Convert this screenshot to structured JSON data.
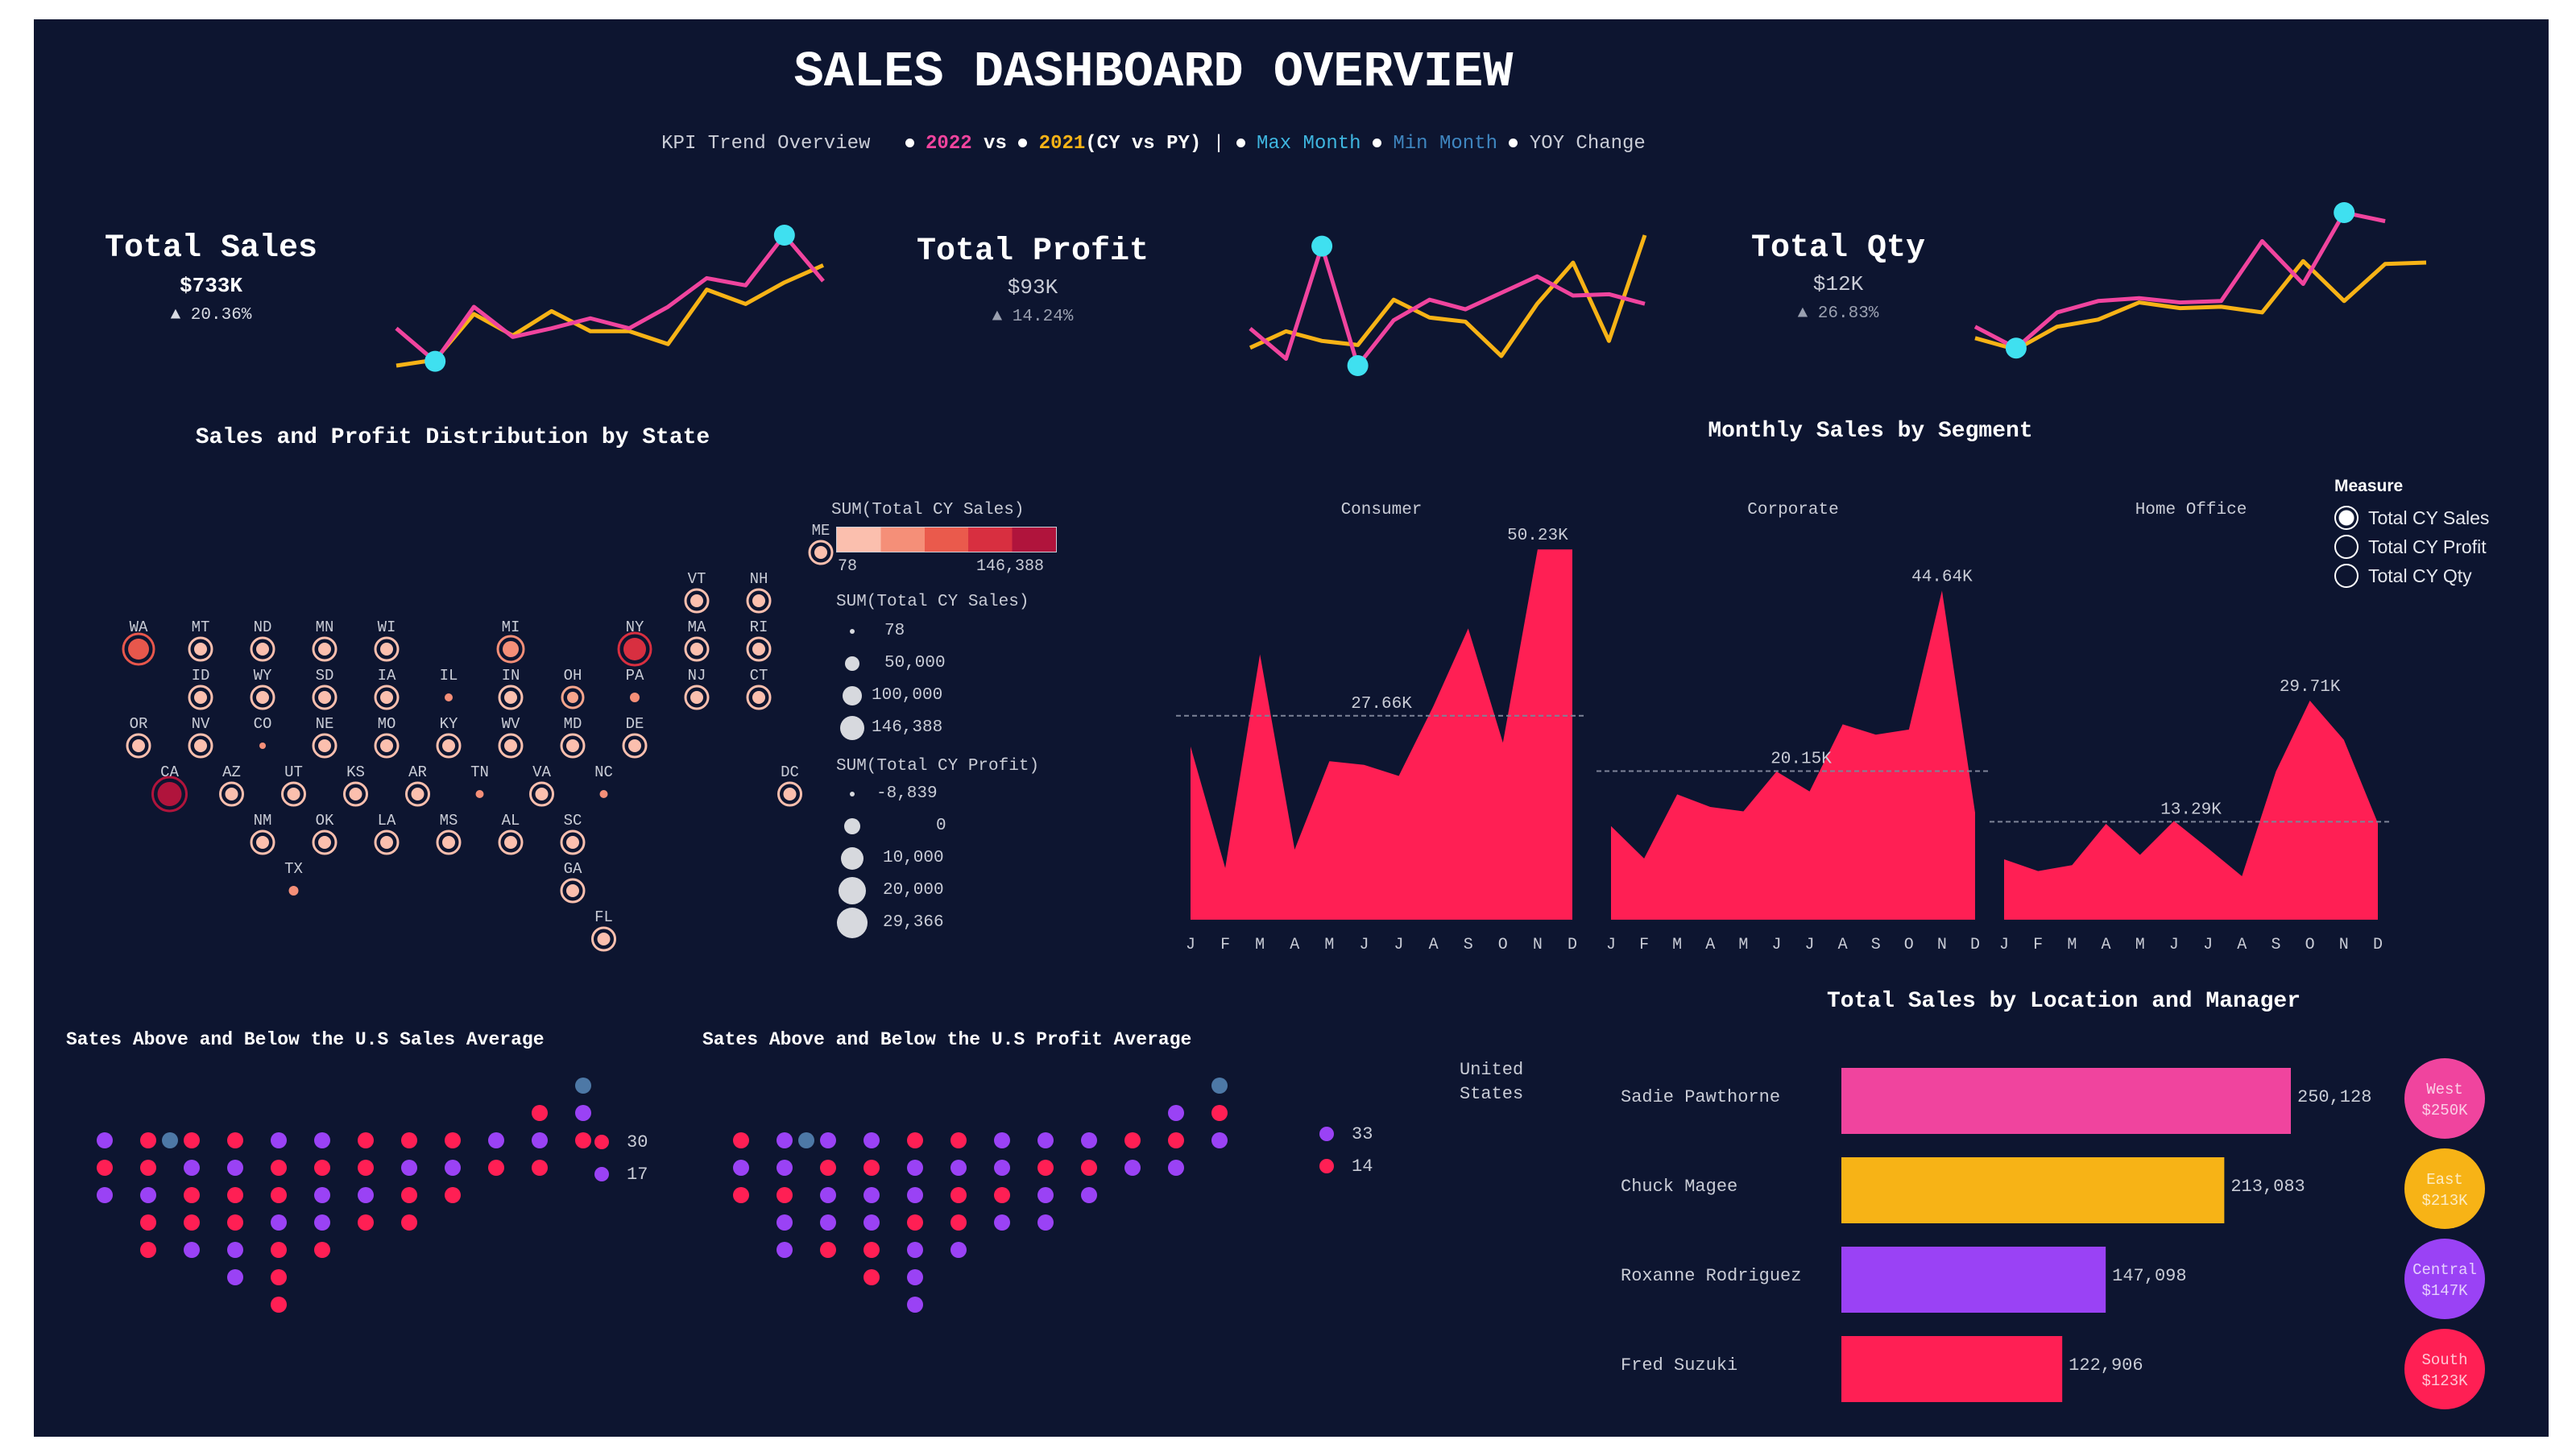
{
  "header": {
    "title": "SALES DASHBOARD OVERVIEW",
    "subtitle_prefix": "KPI Trend Overview",
    "cy_label": "2022",
    "vs_label": "vs",
    "py_label": "2021",
    "cy_vs_py": "(CY vs PY)",
    "sep": "|",
    "max_month": "Max Month",
    "min_month": "Min Month",
    "yoy": "YOY Change"
  },
  "colors": {
    "background": "#0d1530",
    "cy": "#f0449e",
    "py": "#f7b316",
    "max_min_marker": "#3fe0f0",
    "bar_red": "#ff1f54",
    "purple": "#9a42f5",
    "blue_gray": "#4d78a6"
  },
  "kpis": [
    {
      "name": "Total Sales",
      "value": "$733K",
      "change": "▲ 20.36%"
    },
    {
      "name": "Total Profit",
      "value": "$93K",
      "change": "▲ 14.24%"
    },
    {
      "name": "Total Qty",
      "value": "$12K",
      "change": "▲ 26.83%"
    }
  ],
  "map": {
    "title": "Sales and Profit Distribution by State",
    "states": [
      "ME",
      "VT",
      "NH",
      "WA",
      "MT",
      "ND",
      "MN",
      "WI",
      "MI",
      "NY",
      "MA",
      "RI",
      "ID",
      "WY",
      "SD",
      "IA",
      "IL",
      "IN",
      "OH",
      "PA",
      "NJ",
      "CT",
      "OR",
      "NV",
      "CO",
      "NE",
      "MO",
      "KY",
      "WV",
      "MD",
      "DE",
      "CA",
      "AZ",
      "UT",
      "KS",
      "AR",
      "TN",
      "VA",
      "NC",
      "DC",
      "NM",
      "OK",
      "LA",
      "MS",
      "AL",
      "SC",
      "TX",
      "GA",
      "FL"
    ],
    "color_legend_title": "SUM(Total CY Sales)",
    "color_legend_min": "78",
    "color_legend_max": "146,388",
    "size_legend_sales_title": "SUM(Total CY Sales)",
    "size_legend_sales": [
      "78",
      "50,000",
      "100,000",
      "146,388"
    ],
    "size_legend_profit_title": "SUM(Total CY Profit)",
    "size_legend_profit": [
      "-8,839",
      "0",
      "10,000",
      "20,000",
      "29,366"
    ]
  },
  "segment": {
    "title": "Monthly Sales by Segment",
    "measure_title": "Measure",
    "measures": [
      "Total CY Sales",
      "Total CY Profit",
      "Total CY Qty"
    ],
    "selected_measure": "Total CY Sales"
  },
  "sales_avg": {
    "title": "Sates Above and Below the U.S Sales Average",
    "legend": [
      {
        "value": "30",
        "color": "#ff1f54"
      },
      {
        "value": "17",
        "color": "#9a42f5"
      }
    ]
  },
  "profit_avg": {
    "title": "Sates Above and Below the U.S Profit Average",
    "legend": [
      {
        "value": "33",
        "color": "#9a42f5"
      },
      {
        "value": "14",
        "color": "#ff1f54"
      }
    ]
  },
  "location": {
    "title": "Total Sales by Location and Manager",
    "country": "United States",
    "managers": [
      {
        "name": "Sadie Pawthorne",
        "value_label": "250,128",
        "color": "#f0449e",
        "region": "West",
        "region_value": "$250K"
      },
      {
        "name": "Chuck Magee",
        "value_label": "213,083",
        "color": "#f7b316",
        "region": "East",
        "region_value": "$213K"
      },
      {
        "name": "Roxanne Rodriguez",
        "value_label": "147,098",
        "color": "#9a42f5",
        "region": "Central",
        "region_value": "$147K"
      },
      {
        "name": "Fred Suzuki",
        "value_label": "122,906",
        "color": "#ff1f54",
        "region": "South",
        "region_value": "$123K"
      }
    ]
  },
  "chart_data": [
    {
      "type": "line",
      "title": "Total Sales",
      "x": [
        "Jan",
        "Feb",
        "Mar",
        "Apr",
        "May",
        "Jun",
        "Jul",
        "Aug",
        "Sep",
        "Oct",
        "Nov",
        "Dec"
      ],
      "series": [
        {
          "name": "2022",
          "values": [
            35,
            12,
            50,
            29,
            35,
            42,
            35,
            50,
            70,
            65,
            100,
            68
          ]
        },
        {
          "name": "2021",
          "values": [
            9,
            13,
            45,
            30,
            47,
            33,
            33,
            24,
            62,
            52,
            67,
            79
          ]
        }
      ],
      "max_month_index": 10,
      "min_month_index": 1
    },
    {
      "type": "line",
      "title": "Total Profit",
      "x": [
        "Jan",
        "Feb",
        "Mar",
        "Apr",
        "May",
        "Jun",
        "Jul",
        "Aug",
        "Sep",
        "Oct",
        "Nov",
        "Dec"
      ],
      "series": [
        {
          "name": "2022",
          "values": [
            32,
            10,
            92,
            5,
            38,
            53,
            46,
            58,
            70,
            56,
            57,
            50
          ]
        },
        {
          "name": "2021",
          "values": [
            18,
            30,
            23,
            20,
            53,
            40,
            37,
            12,
            50,
            80,
            23,
            100
          ]
        }
      ],
      "max_month_index": 2,
      "min_month_index": 3
    },
    {
      "type": "line",
      "title": "Total Qty",
      "x": [
        "Jan",
        "Feb",
        "Mar",
        "Apr",
        "May",
        "Jun",
        "Jul",
        "Aug",
        "Sep",
        "Oct",
        "Nov",
        "Dec"
      ],
      "series": [
        {
          "name": "2022",
          "values": [
            20,
            5,
            30,
            38,
            40,
            37,
            38,
            80,
            50,
            100,
            94
          ]
        },
        {
          "name": "2021",
          "values": [
            12,
            4,
            20,
            25,
            37,
            33,
            34,
            30,
            66,
            38,
            64,
            65
          ]
        }
      ],
      "max_month_index": 9,
      "min_month_index": 1
    },
    {
      "type": "area",
      "title": "Monthly Sales by Segment",
      "x": [
        "J",
        "F",
        "M",
        "A",
        "M",
        "J",
        "J",
        "A",
        "S",
        "O",
        "N",
        "D"
      ],
      "ylim": [
        0,
        52000
      ],
      "series": [
        {
          "name": "Consumer",
          "values": [
            23500,
            7000,
            36000,
            9500,
            21500,
            21000,
            19500,
            29000,
            39500,
            24000,
            50230,
            50230
          ],
          "avg": 27660,
          "avg_label": "27.66K",
          "max_label": "50.23K"
        },
        {
          "name": "Corporate",
          "values": [
            12700,
            8300,
            17000,
            15300,
            14700,
            20100,
            17400,
            26500,
            25100,
            25800,
            44640,
            14500
          ],
          "avg": 20150,
          "avg_label": "20.15K",
          "max_label": "44.64K"
        },
        {
          "name": "Home Office",
          "values": [
            8200,
            6600,
            7400,
            13000,
            8800,
            13400,
            9700,
            5900,
            20100,
            29710,
            24400,
            13100
          ],
          "avg": 13290,
          "avg_label": "13.29K",
          "max_label": "29.71K"
        }
      ]
    },
    {
      "type": "bar",
      "title": "Total Sales by Location and Manager",
      "categories": [
        "Sadie Pawthorne",
        "Chuck Magee",
        "Roxanne Rodriguez",
        "Fred Suzuki"
      ],
      "values": [
        250128,
        213083,
        147098,
        122906
      ]
    }
  ]
}
